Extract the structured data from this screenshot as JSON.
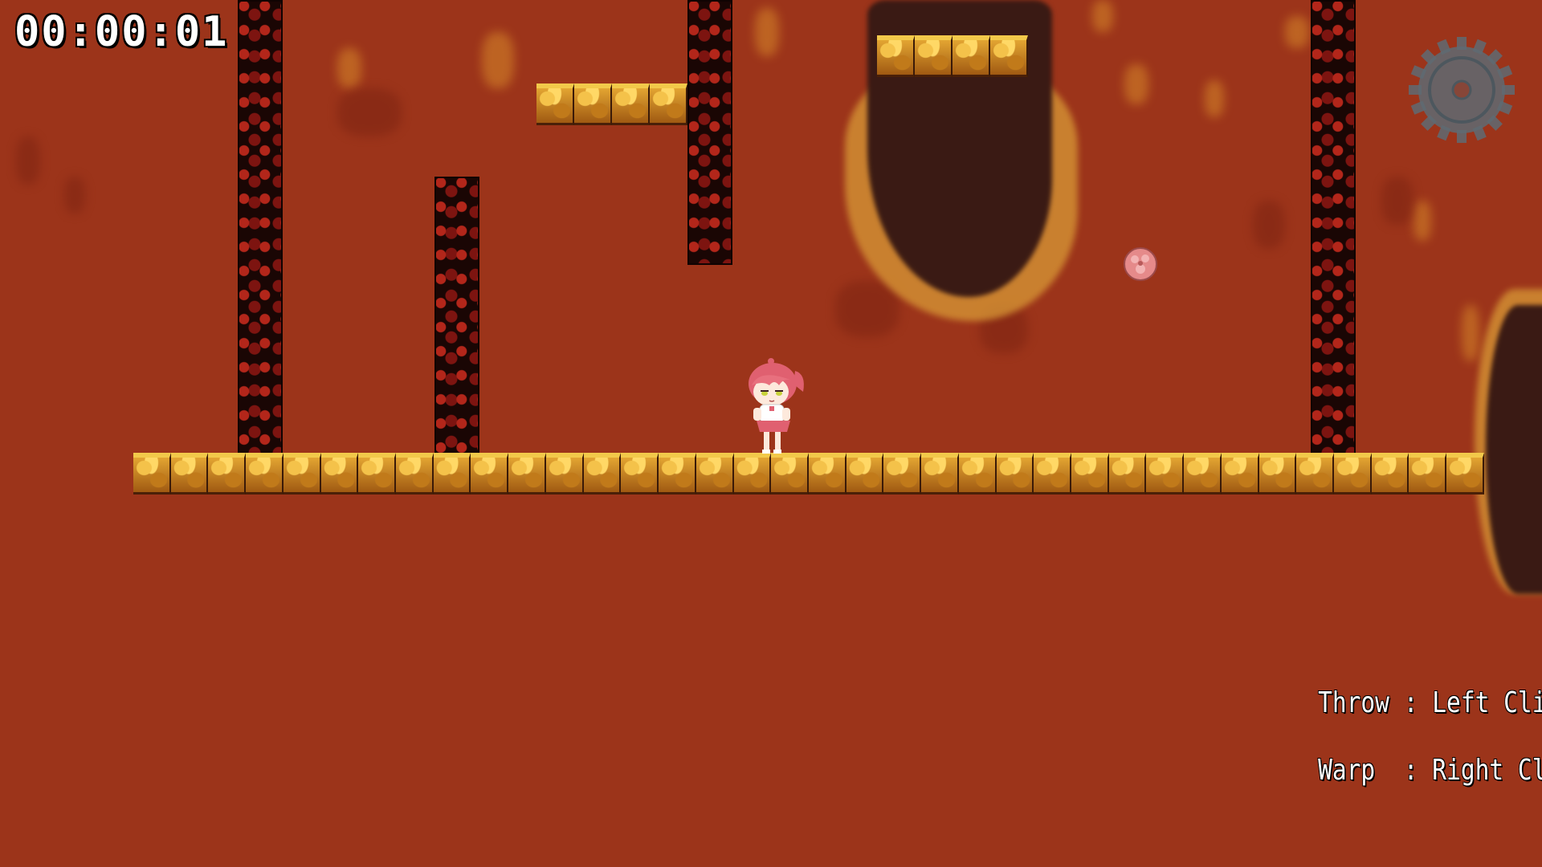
{
  "hud": {
    "timer": "00:00:01",
    "settings_icon": "gear-icon"
  },
  "controls": {
    "throw_label": "Throw",
    "throw_sep": " : ",
    "throw_action": "Left Click",
    "warp_label": "Warp",
    "warp_sep": "  : ",
    "warp_action": "Right Click"
  },
  "colors": {
    "background": "#9c341a",
    "block_gold": "#e3a532",
    "pillar_black": "#1a0604",
    "hud_text": "#ffffff",
    "gear_gray": "#5f6b73"
  },
  "sprites": {
    "player": "pink-haired-girl-character",
    "item": "pink-orb-item"
  }
}
